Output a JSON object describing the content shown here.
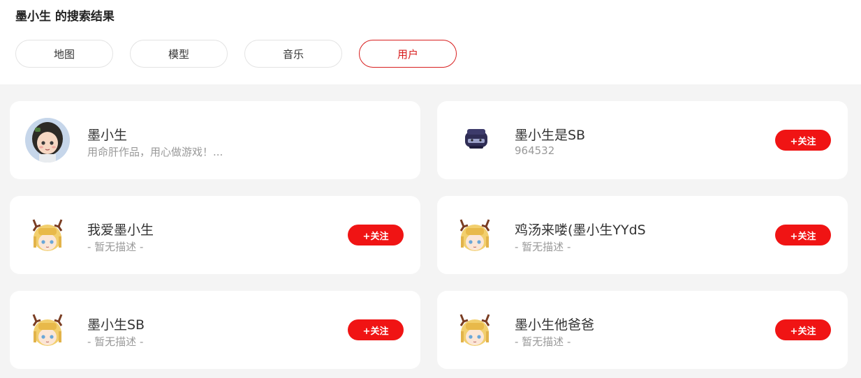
{
  "page": {
    "title": "墨小生 的搜索结果"
  },
  "tabs": [
    {
      "label": "地图",
      "active": false
    },
    {
      "label": "模型",
      "active": false
    },
    {
      "label": "音乐",
      "active": false
    },
    {
      "label": "用户",
      "active": true
    }
  ],
  "colors": {
    "accent": "#d81e1e",
    "follow_button": "#f01414",
    "background": "#f4f4f4"
  },
  "users": [
    {
      "name": "墨小生",
      "desc": "用命肝作品，用心做游戏！...",
      "avatar": "girl-character-avatar",
      "follow_label": ""
    },
    {
      "name": "墨小生是SB",
      "desc": "964532",
      "avatar": "dark-blob-avatar",
      "follow_label": "+关注"
    },
    {
      "name": "我爱墨小生",
      "desc": "- 暂无描述 -",
      "avatar": "antler-girl-avatar",
      "follow_label": "+关注"
    },
    {
      "name": "鸡汤来喽(墨小生YYdS",
      "desc": "- 暂无描述 -",
      "avatar": "antler-girl-avatar",
      "follow_label": "+关注"
    },
    {
      "name": "墨小生SB",
      "desc": "- 暂无描述 -",
      "avatar": "antler-girl-avatar",
      "follow_label": "+关注"
    },
    {
      "name": "墨小生他爸爸",
      "desc": "- 暂无描述 -",
      "avatar": "antler-girl-avatar",
      "follow_label": "+关注"
    }
  ]
}
